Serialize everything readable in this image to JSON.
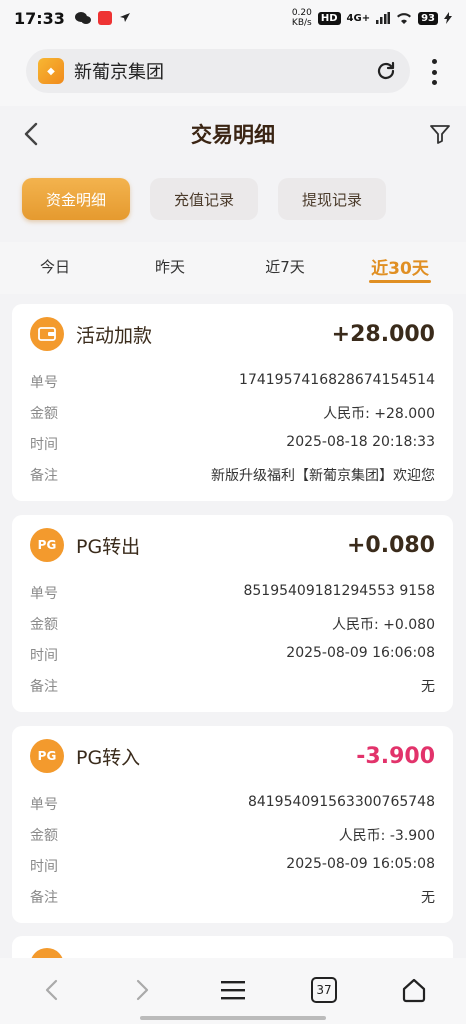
{
  "status_bar": {
    "time": "17:33",
    "net_speed_value": "0.20",
    "net_speed_unit": "KB/s",
    "hd_badge": "HD",
    "network": "4G+",
    "battery": "93"
  },
  "browser": {
    "site_title": "新葡京集团",
    "tab_count": "37"
  },
  "header": {
    "title": "交易明细"
  },
  "segments": [
    {
      "label": "资金明细",
      "active": true
    },
    {
      "label": "充值记录",
      "active": false
    },
    {
      "label": "提现记录",
      "active": false
    }
  ],
  "date_tabs": [
    {
      "label": "今日"
    },
    {
      "label": "昨天"
    },
    {
      "label": "近7天"
    },
    {
      "label": "近30天",
      "active": true
    }
  ],
  "labels": {
    "order_no": "单号",
    "amount": "金额",
    "time": "时间",
    "remark": "备注"
  },
  "transactions": [
    {
      "type": "活动加款",
      "icon": "wallet-icon",
      "amount": "+28.000",
      "order_no": "1741957416828674154514",
      "amount_detail": "人民币: +28.000",
      "time": "2025-08-18 20:18:33",
      "remark": "新版升级福利【新葡京集团】欢迎您"
    },
    {
      "type": "PG转出",
      "icon_text": "PG",
      "amount": "+0.080",
      "order_no": "85195409181294553 9158",
      "amount_detail": "人民币: +0.080",
      "time": "2025-08-09 16:06:08",
      "remark": "无"
    },
    {
      "type": "PG转入",
      "icon_text": "PG",
      "amount": "-3.900",
      "amount_color": "#e2336b",
      "order_no": "841954091563300765748",
      "amount_detail": "人民币: -3.900",
      "time": "2025-08-09 16:05:08",
      "remark": "无"
    }
  ]
}
